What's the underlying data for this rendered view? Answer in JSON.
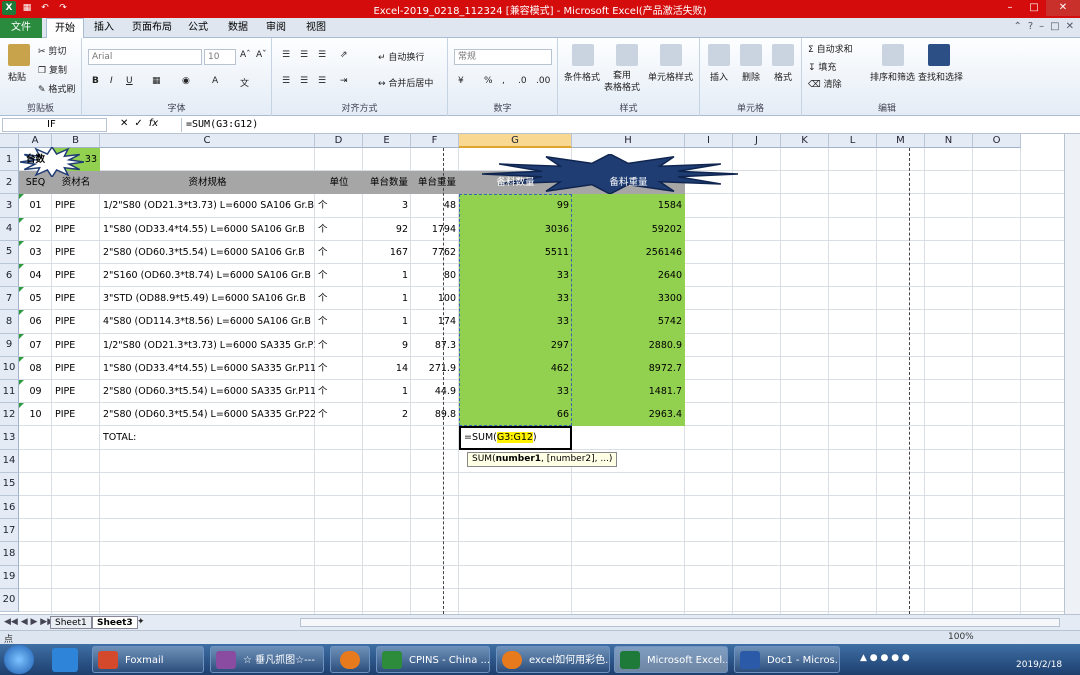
{
  "window": {
    "title": "Excel-2019_0218_112324  [兼容模式] - Microsoft Excel(产品激活失败)"
  },
  "tabs": [
    "文件",
    "开始",
    "插入",
    "页面布局",
    "公式",
    "数据",
    "审阅",
    "视图"
  ],
  "ribbon": {
    "clipboard": {
      "paste": "粘贴",
      "cut": "剪切",
      "copy": "复制",
      "format_painter": "格式刷",
      "label": "剪贴板"
    },
    "font": {
      "name": "Arial",
      "size": "10",
      "bold": "B",
      "italic": "I",
      "underline": "U",
      "label": "字体"
    },
    "alignment": {
      "wrap": "自动换行",
      "merge": "合并后居中",
      "label": "对齐方式"
    },
    "number": {
      "format": "常规",
      "percent": "%",
      "label": "数字"
    },
    "styles": {
      "conditional": "条件格式",
      "table": "套用\n表格格式",
      "cell": "单元格样式",
      "label": "样式"
    },
    "cells": {
      "insert": "插入",
      "delete": "删除",
      "format": "格式",
      "label": "单元格"
    },
    "editing": {
      "autosum": "自动求和",
      "fill": "填充",
      "clear": "清除",
      "sort": "排序和筛选",
      "find": "查找和选择",
      "label": "编辑"
    }
  },
  "formula_bar": {
    "name_box": "IF",
    "fx": "fx",
    "formula": "=SUM(G3:G12)"
  },
  "columns": [
    "A",
    "B",
    "C",
    "D",
    "E",
    "F",
    "G",
    "H",
    "I",
    "J",
    "K",
    "L",
    "M",
    "N",
    "O"
  ],
  "rows": [
    "1",
    "2",
    "3",
    "4",
    "5",
    "6",
    "7",
    "8",
    "9",
    "10",
    "11",
    "12",
    "13",
    "14",
    "15",
    "16",
    "17",
    "18",
    "19",
    "20"
  ],
  "sheet": {
    "a1": "台数",
    "b1": "33",
    "headers": [
      "SEQ",
      "资材名",
      "资材规格",
      "单位",
      "单台数量",
      "单台重量",
      "备料数量",
      "备料重量"
    ],
    "data": [
      [
        "01",
        "PIPE",
        "1/2\"S80 (OD21.3*t3.73) L=6000 SA106 Gr.B",
        "个",
        "3",
        "48",
        "99",
        "1584"
      ],
      [
        "02",
        "PIPE",
        "1\"S80 (OD33.4*t4.55) L=6000 SA106 Gr.B",
        "个",
        "92",
        "1794",
        "3036",
        "59202"
      ],
      [
        "03",
        "PIPE",
        "2\"S80 (OD60.3*t5.54) L=6000 SA106 Gr.B",
        "个",
        "167",
        "7762",
        "5511",
        "256146"
      ],
      [
        "04",
        "PIPE",
        "2\"S160 (OD60.3*t8.74) L=6000 SA106 Gr.B",
        "个",
        "1",
        "80",
        "33",
        "2640"
      ],
      [
        "05",
        "PIPE",
        "3\"STD (OD88.9*t5.49) L=6000 SA106 Gr.B",
        "个",
        "1",
        "100",
        "33",
        "3300"
      ],
      [
        "06",
        "PIPE",
        "4\"S80 (OD114.3*t8.56) L=6000 SA106 Gr.B",
        "个",
        "1",
        "174",
        "33",
        "5742"
      ],
      [
        "07",
        "PIPE",
        "1/2\"S80 (OD21.3*t3.73) L=6000 SA335 Gr.P11",
        "个",
        "9",
        "87.3",
        "297",
        "2880.9"
      ],
      [
        "08",
        "PIPE",
        "1\"S80 (OD33.4*t4.55) L=6000 SA335 Gr.P11",
        "个",
        "14",
        "271.9",
        "462",
        "8972.7"
      ],
      [
        "09",
        "PIPE",
        "2\"S80 (OD60.3*t5.54) L=6000 SA335 Gr.P11",
        "个",
        "1",
        "44.9",
        "33",
        "1481.7"
      ],
      [
        "10",
        "PIPE",
        "2\"S80 (OD60.3*t5.54) L=6000 SA335 Gr.P22",
        "个",
        "2",
        "89.8",
        "66",
        "2963.4"
      ]
    ],
    "total_label": "TOTAL:",
    "edit_prefix": "=SUM(",
    "edit_ref": "G3:G12",
    "edit_suffix": ")",
    "tooltip_fn": "SUM(",
    "tooltip_arg1": "number1",
    "tooltip_rest": ", [number2], ...)"
  },
  "sheet_tabs": [
    "Sheet1",
    "Sheet3"
  ],
  "status": {
    "mode": "点",
    "zoom": "100%"
  },
  "taskbar": {
    "items": [
      "Foxmail",
      "☆ 垂凡抓图☆---",
      "",
      "CPINS - China ...",
      "excel如何用彩色...",
      "Microsoft Excel...",
      "Doc1 - Micros..."
    ],
    "time": "",
    "date": "2019/2/18"
  },
  "colors": {
    "green_fill": "#92d050",
    "header_gray": "#a6a6a6",
    "title_red": "#d40c0c",
    "star_fill": "#1f3d73"
  }
}
